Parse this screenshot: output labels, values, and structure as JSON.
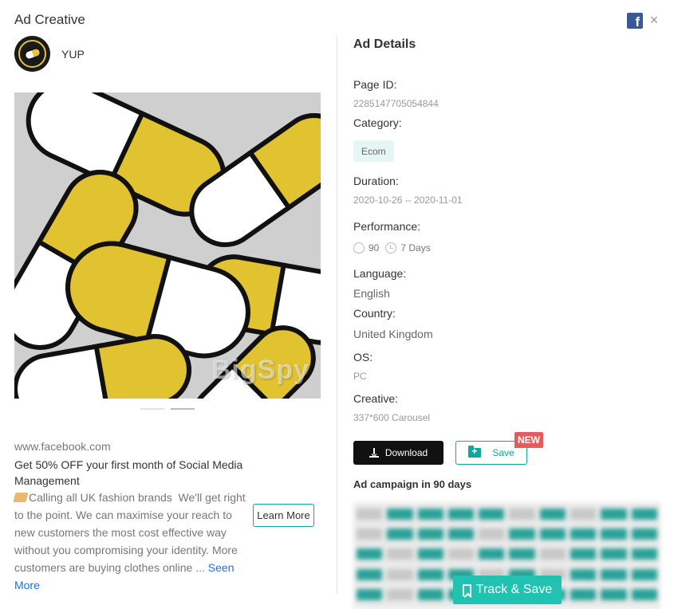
{
  "modal": {
    "title": "Ad Creative"
  },
  "advertiser": {
    "name": "YUP"
  },
  "creative": {
    "watermark": "BigSpy",
    "carousel_count": 2,
    "active_index": 1
  },
  "ad": {
    "domain": "www.facebook.com",
    "headline": "Get 50% OFF your first month of Social Media Management",
    "body": "Calling all UK fashion brands  We'll get right to the point. We can maximise your reach to new customers the most cost effective way without you compromising your identity. More customers are buying clothes online ...",
    "seen_more": "Seen More",
    "cta": "Learn More"
  },
  "details": {
    "title": "Ad Details",
    "page_id_label": "Page ID:",
    "page_id": "2285147705054844",
    "category_label": "Category:",
    "category": "Ecom",
    "duration_label": "Duration:",
    "duration": "2020-10-26 -- 2020-11-01",
    "performance_label": "Performance:",
    "performance_score": "90",
    "performance_days": "7 Days",
    "language_label": "Language:",
    "language": "English",
    "country_label": "Country:",
    "country": "United Kingdom",
    "os_label": "OS:",
    "os": "PC",
    "creative_label": "Creative:",
    "creative": "337*600 Carousel"
  },
  "actions": {
    "download": "Download",
    "save": "Save",
    "new_badge": "NEW"
  },
  "campaign": {
    "title": "Ad campaign in 90 days",
    "track_save": "Track & Save"
  },
  "colors": {
    "accent": "#11a79c",
    "facebook": "#3b5998",
    "badge": "#e25c5c"
  }
}
